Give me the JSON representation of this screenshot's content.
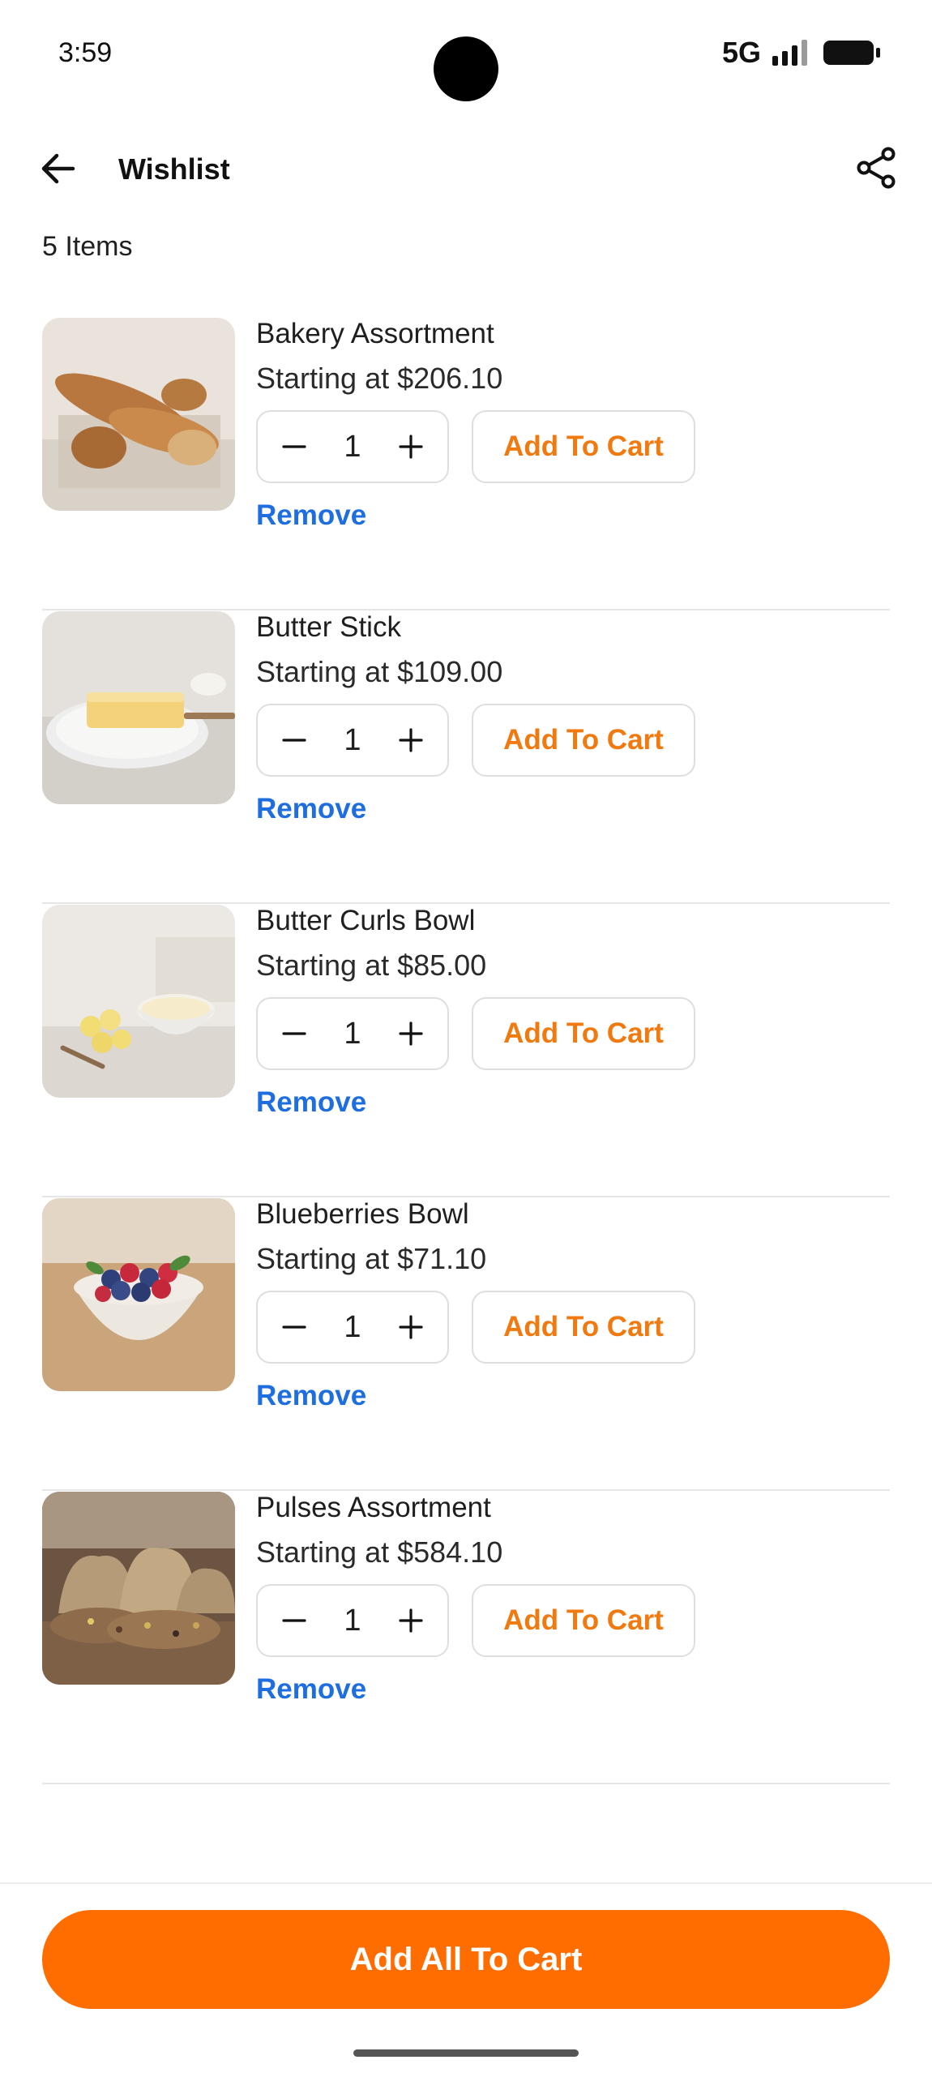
{
  "status_bar": {
    "time": "3:59",
    "network": "5G"
  },
  "header": {
    "title": "Wishlist",
    "back_icon": "arrow-left-icon",
    "share_icon": "share-icon"
  },
  "summary": {
    "items_count_label": "5 Items"
  },
  "items": [
    {
      "name": "Bakery Assortment",
      "price_label": "Starting at $206.10",
      "quantity": "1",
      "add_label": "Add To Cart",
      "remove_label": "Remove"
    },
    {
      "name": "Butter Stick",
      "price_label": "Starting at $109.00",
      "quantity": "1",
      "add_label": "Add To Cart",
      "remove_label": "Remove"
    },
    {
      "name": "Butter Curls Bowl",
      "price_label": "Starting at $85.00",
      "quantity": "1",
      "add_label": "Add To Cart",
      "remove_label": "Remove"
    },
    {
      "name": "Blueberries Bowl",
      "price_label": "Starting at $71.10",
      "quantity": "1",
      "add_label": "Add To Cart",
      "remove_label": "Remove"
    },
    {
      "name": "Pulses Assortment",
      "price_label": "Starting at $584.10",
      "quantity": "1",
      "add_label": "Add To Cart",
      "remove_label": "Remove"
    }
  ],
  "footer": {
    "add_all_label": "Add All To Cart"
  },
  "colors": {
    "accent": "#FF6D00",
    "add_text": "#F07A10",
    "link": "#1E6EE0",
    "divider": "#E6E6E6"
  }
}
